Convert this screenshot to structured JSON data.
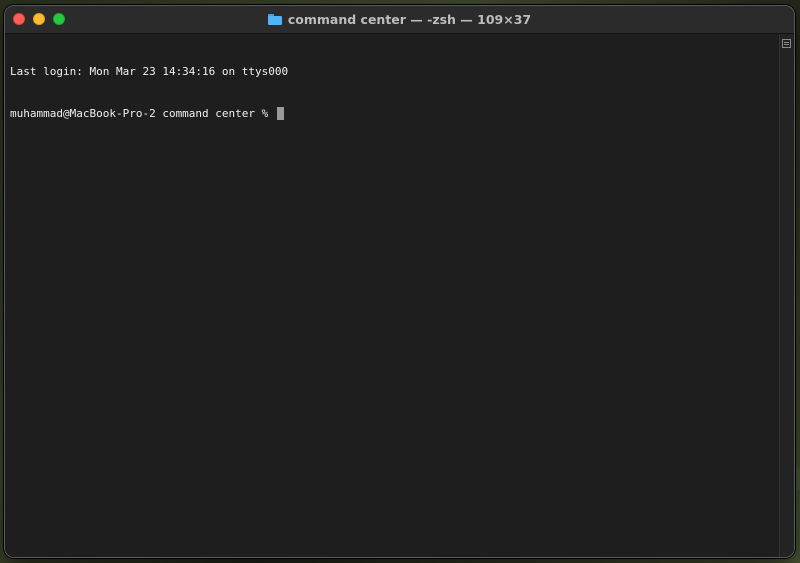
{
  "window": {
    "title": "command center — -zsh — 109×37",
    "folder_icon": "folder-icon"
  },
  "terminal": {
    "lines": [
      "Last login: Mon Mar 23 14:34:16 on ttys000",
      "muhammad@MacBook-Pro-2 command center % "
    ]
  },
  "colors": {
    "close": "#fe5f57",
    "minimize": "#febc2e",
    "zoom": "#28c840",
    "terminal_bg": "#1e1e1e",
    "terminal_fg": "#f0f0f0"
  }
}
